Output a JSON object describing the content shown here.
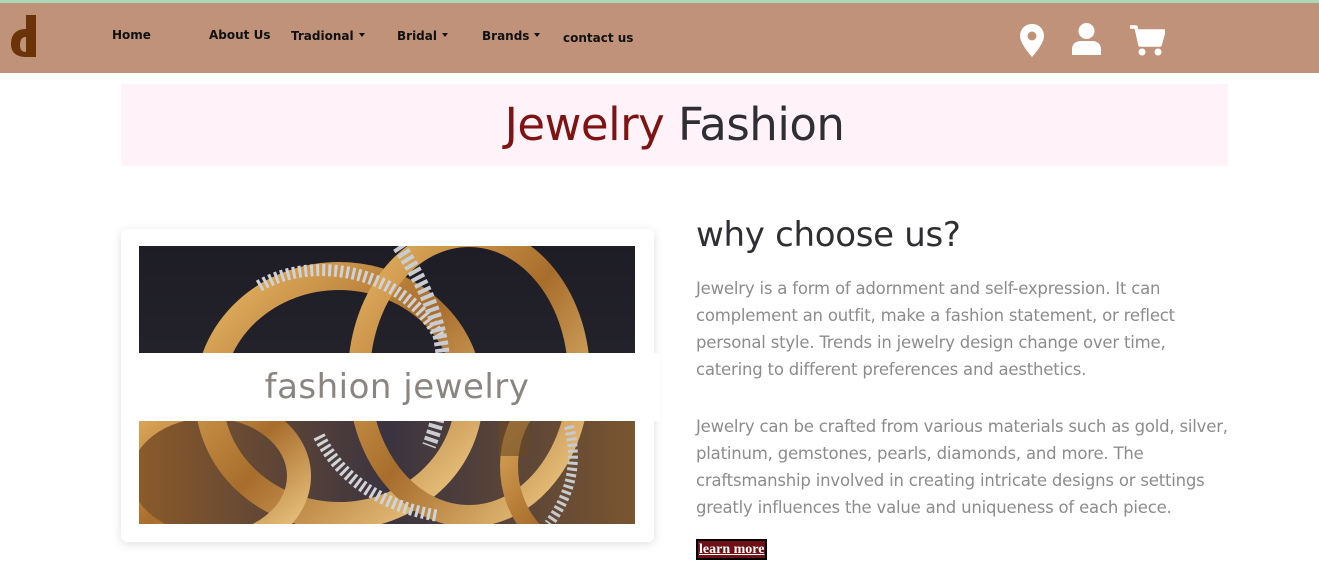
{
  "nav": {
    "items": [
      {
        "label": "Home"
      },
      {
        "label": "About Us"
      },
      {
        "label": "Tradional"
      },
      {
        "label": "Bridal"
      },
      {
        "label": "Brands"
      },
      {
        "label": "contact us"
      }
    ],
    "icons": [
      "location-icon",
      "user-icon",
      "cart-icon"
    ]
  },
  "hero": {
    "title_accent": "Jewelry",
    "title_rest": " Fashion"
  },
  "image": {
    "overlay_text": "fashion jewelry"
  },
  "section": {
    "heading": "why choose us?",
    "paragraph1": "Jewelry is a form of adornment and self-expression. It can complement an outfit, make a fashion statement, or reflect personal style. Trends in jewelry design change over time, catering to different preferences and aesthetics.",
    "paragraph2": "Jewelry can be crafted from various materials such as gold, silver, platinum, gemstones, pearls, diamonds, and more. The craftsmanship involved in creating intricate designs or settings greatly influences the value and uniqueness of each piece.",
    "button_label": "learn more"
  },
  "colors": {
    "navbar": "#c0927a",
    "accent": "#7d1313",
    "hero_bg": "#fff2f8",
    "button_bg": "#6e1116",
    "logo": "#6b3308"
  }
}
